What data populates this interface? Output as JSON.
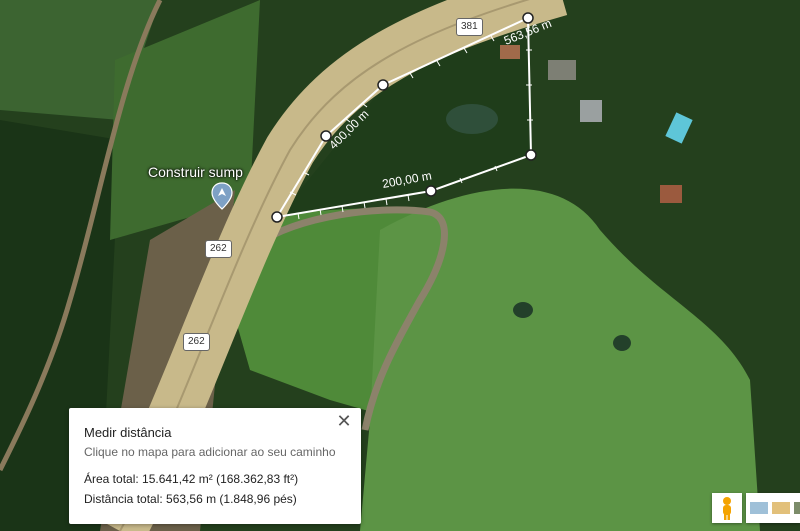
{
  "map": {
    "place_label": "Construir sump",
    "road_labels": [
      "381",
      "262",
      "262"
    ],
    "segment_labels": {
      "s1": "200,00 m",
      "s2": "400,00 m",
      "s3": "563,56 m"
    }
  },
  "panel": {
    "title": "Medir distância",
    "hint": "Clique no mapa para adicionar ao seu caminho",
    "area": "Área total: 15.641,42 m² (168.362,83 ft²)",
    "distance": "Distância total: 563,56 m (1.848,96 pés)",
    "close_symbol": "✕"
  },
  "colors": {
    "highway": "#c8b98a",
    "field": "#5f8e48",
    "forest": "#1d3b18",
    "measure_line": "#ffffff"
  },
  "icons": [
    "pin-icon",
    "close-icon",
    "pegman-icon",
    "layer-thumbnail-icon"
  ]
}
